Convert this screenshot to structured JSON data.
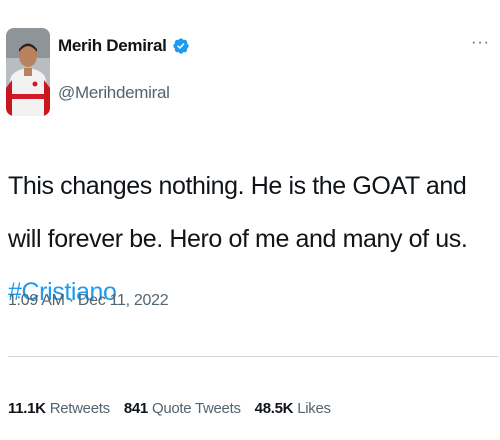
{
  "author": {
    "name": "Merih Demiral",
    "handle": "@Merihdemiral",
    "verified": true
  },
  "more_icon": "more-horizontal-icon",
  "tweet": {
    "text_before": "This changes nothing. He is the GOAT and will forever be. Hero of me and many of us. ",
    "hashtag": "#Cristiano"
  },
  "timestamp": "1:09 AM · Dec 11, 2022",
  "stats": [
    {
      "value": "11.1K",
      "label": "Retweets"
    },
    {
      "value": "841",
      "label": "Quote Tweets"
    },
    {
      "value": "48.5K",
      "label": "Likes"
    }
  ],
  "colors": {
    "accent": "#1d9bf0",
    "secondary_text": "#536471",
    "primary_text": "#0f1419",
    "divider": "#cfd9de"
  }
}
